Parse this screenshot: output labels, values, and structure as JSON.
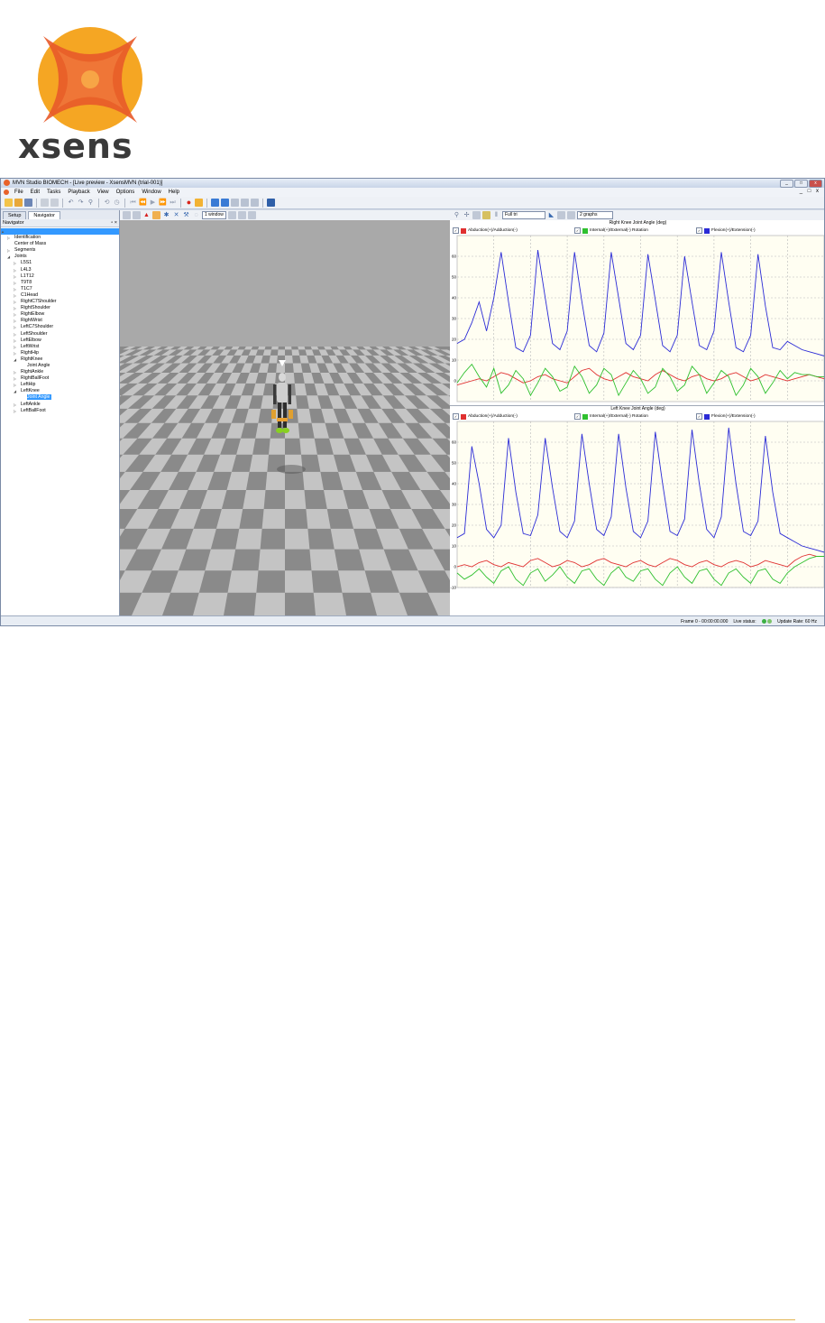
{
  "logo": {
    "text": "xsens"
  },
  "window": {
    "title": "MVN Studio BIOMECH - [Live preview - XsensMVN (trial-001)]",
    "controls": [
      "_",
      "□",
      "x"
    ]
  },
  "menu": [
    "File",
    "Edit",
    "Tasks",
    "Playback",
    "View",
    "Options",
    "Window",
    "Help"
  ],
  "navigator": {
    "tabs": [
      "Setup",
      "Navigator"
    ],
    "header": "Navigator",
    "items": [
      {
        "label": "",
        "indent": 0,
        "arrow": "▲",
        "rootsel": true
      },
      {
        "label": "Identification",
        "indent": 1,
        "arrow": "▷"
      },
      {
        "label": "Center of Mass",
        "indent": 1,
        "arrow": ""
      },
      {
        "label": "Segments",
        "indent": 1,
        "arrow": "▷"
      },
      {
        "label": "Joints",
        "indent": 1,
        "arrow": "◢"
      },
      {
        "label": "L5S1",
        "indent": 2,
        "arrow": "▷"
      },
      {
        "label": "L4L3",
        "indent": 2,
        "arrow": "▷"
      },
      {
        "label": "L1T12",
        "indent": 2,
        "arrow": "▷"
      },
      {
        "label": "T9T8",
        "indent": 2,
        "arrow": "▷"
      },
      {
        "label": "T1C7",
        "indent": 2,
        "arrow": "▷"
      },
      {
        "label": "C1Head",
        "indent": 2,
        "arrow": "▷"
      },
      {
        "label": "RightC7Shoulder",
        "indent": 2,
        "arrow": "▷"
      },
      {
        "label": "RightShoulder",
        "indent": 2,
        "arrow": "▷"
      },
      {
        "label": "RightElbow",
        "indent": 2,
        "arrow": "▷"
      },
      {
        "label": "RightWrist",
        "indent": 2,
        "arrow": "▷"
      },
      {
        "label": "LeftC7Shoulder",
        "indent": 2,
        "arrow": "▷"
      },
      {
        "label": "LeftShoulder",
        "indent": 2,
        "arrow": "▷"
      },
      {
        "label": "LeftElbow",
        "indent": 2,
        "arrow": "▷"
      },
      {
        "label": "LeftWrist",
        "indent": 2,
        "arrow": "▷"
      },
      {
        "label": "RightHip",
        "indent": 2,
        "arrow": "▷"
      },
      {
        "label": "RightKnee",
        "indent": 2,
        "arrow": "◢"
      },
      {
        "label": "Joint Angle",
        "indent": 3,
        "arrow": ""
      },
      {
        "label": "RightAnkle",
        "indent": 2,
        "arrow": "▷"
      },
      {
        "label": "RightBallFoot",
        "indent": 2,
        "arrow": "▷"
      },
      {
        "label": "LeftHip",
        "indent": 2,
        "arrow": "▷"
      },
      {
        "label": "LeftKnee",
        "indent": 2,
        "arrow": "◢"
      },
      {
        "label": "Joint Angle",
        "indent": 3,
        "arrow": "",
        "selected": true
      },
      {
        "label": "LeftAnkle",
        "indent": 2,
        "arrow": "▷"
      },
      {
        "label": "LeftBallFoot",
        "indent": 2,
        "arrow": "▷"
      }
    ]
  },
  "viewport": {
    "view_combo": "1 window"
  },
  "graphs_toolbar": {
    "time_combo": "Full tri",
    "layout_combo": "2 graphs"
  },
  "legend": {
    "abduction": "Abduction(+)/Adduction(-)",
    "rotation": "Internal(+)/External(-) Rotation",
    "flexion": "Flexion(+)/Extension(-)"
  },
  "colors": {
    "abduction": "#e03030",
    "rotation": "#2fc02f",
    "flexion": "#2b2bd6"
  },
  "status": {
    "frame": "Frame 0 - 00:00:00.000",
    "live_status": "Live status:",
    "update_rate": "Update Rate: 60 Hz"
  },
  "chart_data": [
    {
      "type": "line",
      "title": "Right Knee Joint Angle (deg)",
      "ylim": [
        -10,
        70
      ],
      "yticks": [
        60,
        50,
        40,
        30,
        20,
        10,
        0
      ],
      "grid": true,
      "x": [
        0,
        2,
        4,
        6,
        8,
        10,
        12,
        14,
        16,
        18,
        20,
        22,
        24,
        26,
        28,
        30,
        32,
        34,
        36,
        38,
        40,
        42,
        44,
        46,
        48,
        50,
        52,
        54,
        56,
        58,
        60,
        62,
        64,
        66,
        68,
        70,
        72,
        74,
        76,
        78,
        80,
        82,
        84,
        86,
        88,
        90,
        92,
        94,
        96,
        98,
        100
      ],
      "series": [
        {
          "name": "Abduction(+)/Adduction(-)",
          "values": [
            -2,
            -1,
            0,
            1,
            0,
            2,
            4,
            3,
            1,
            -1,
            0,
            2,
            3,
            1,
            0,
            -1,
            2,
            5,
            6,
            3,
            1,
            0,
            2,
            4,
            2,
            1,
            0,
            3,
            5,
            3,
            1,
            0,
            2,
            3,
            1,
            0,
            1,
            3,
            4,
            2,
            0,
            1,
            3,
            2,
            1,
            0,
            1,
            2,
            3,
            2,
            1
          ]
        },
        {
          "name": "Internal(+)/External(-) Rotation",
          "values": [
            -1,
            4,
            8,
            2,
            -3,
            6,
            -6,
            -2,
            5,
            1,
            -7,
            -1,
            6,
            2,
            -5,
            -3,
            7,
            2,
            -6,
            -2,
            6,
            3,
            -7,
            -1,
            5,
            1,
            -6,
            -3,
            6,
            2,
            -5,
            -2,
            7,
            3,
            -6,
            -1,
            5,
            2,
            -7,
            -2,
            6,
            2,
            -6,
            -1,
            5,
            1,
            4,
            3,
            3,
            2,
            2
          ]
        },
        {
          "name": "Flexion(+)/Extension(-)",
          "values": [
            18,
            20,
            28,
            38,
            24,
            40,
            62,
            38,
            16,
            14,
            22,
            63,
            40,
            18,
            15,
            24,
            62,
            38,
            17,
            14,
            23,
            62,
            40,
            18,
            15,
            22,
            61,
            39,
            17,
            14,
            22,
            60,
            38,
            17,
            15,
            24,
            62,
            38,
            16,
            14,
            22,
            61,
            36,
            16,
            15,
            19,
            17,
            15,
            14,
            13,
            12
          ]
        }
      ]
    },
    {
      "type": "line",
      "title": "Left Knee Joint Angle (deg)",
      "ylim": [
        -10,
        70
      ],
      "yticks": [
        60,
        50,
        40,
        30,
        20,
        10,
        0,
        -10
      ],
      "grid": true,
      "x": [
        0,
        2,
        4,
        6,
        8,
        10,
        12,
        14,
        16,
        18,
        20,
        22,
        24,
        26,
        28,
        30,
        32,
        34,
        36,
        38,
        40,
        42,
        44,
        46,
        48,
        50,
        52,
        54,
        56,
        58,
        60,
        62,
        64,
        66,
        68,
        70,
        72,
        74,
        76,
        78,
        80,
        82,
        84,
        86,
        88,
        90,
        92,
        94,
        96,
        98,
        100
      ],
      "series": [
        {
          "name": "Abduction(+)/Adduction(-)",
          "values": [
            0,
            1,
            0,
            2,
            3,
            1,
            0,
            2,
            1,
            0,
            3,
            4,
            2,
            0,
            1,
            3,
            2,
            0,
            1,
            3,
            4,
            2,
            1,
            0,
            2,
            3,
            1,
            0,
            2,
            4,
            3,
            1,
            0,
            2,
            3,
            1,
            0,
            2,
            3,
            2,
            0,
            1,
            3,
            2,
            1,
            0,
            3,
            5,
            6,
            5,
            5
          ]
        },
        {
          "name": "Internal(+)/External(-) Rotation",
          "values": [
            -3,
            -6,
            -4,
            -1,
            -5,
            -8,
            -2,
            0,
            -6,
            -9,
            -3,
            -1,
            -7,
            -4,
            0,
            -5,
            -8,
            -2,
            -1,
            -6,
            -9,
            -3,
            0,
            -5,
            -7,
            -2,
            -1,
            -6,
            -9,
            -3,
            0,
            -5,
            -8,
            -2,
            -1,
            -6,
            -9,
            -3,
            -1,
            -5,
            -8,
            -2,
            -1,
            -6,
            -8,
            -3,
            0,
            2,
            4,
            5,
            5
          ]
        },
        {
          "name": "Flexion(+)/Extension(-)",
          "values": [
            14,
            16,
            58,
            40,
            18,
            14,
            20,
            62,
            36,
            16,
            15,
            25,
            62,
            38,
            17,
            14,
            22,
            64,
            40,
            18,
            15,
            24,
            64,
            38,
            17,
            14,
            22,
            65,
            40,
            17,
            15,
            23,
            66,
            40,
            18,
            14,
            24,
            67,
            40,
            17,
            15,
            22,
            63,
            36,
            16,
            14,
            12,
            10,
            9,
            8,
            7
          ]
        }
      ]
    }
  ]
}
